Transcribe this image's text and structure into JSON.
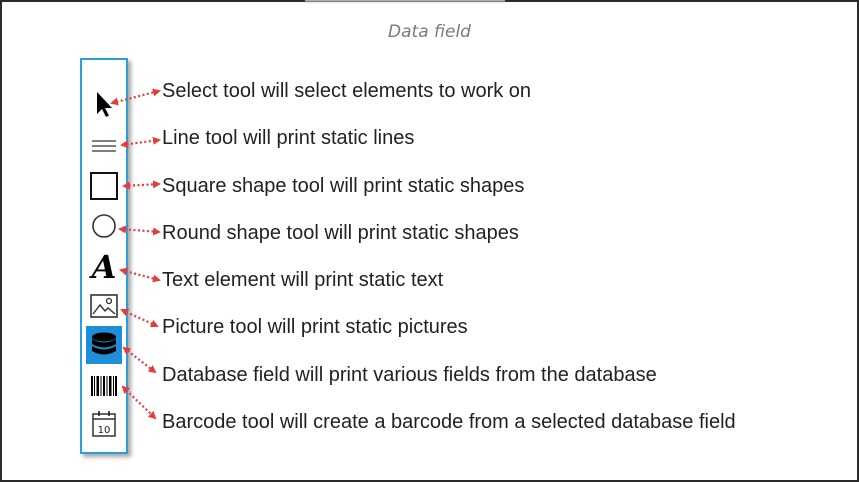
{
  "caption": "Data field",
  "colors": {
    "toolbar_border": "#2a9fe0",
    "selected_tool_bg": "#1e8ed8",
    "arrow": "#e83b3b"
  },
  "tools": [
    {
      "icon": "select-arrow-icon",
      "description": "Select tool will select elements to work on"
    },
    {
      "icon": "line-icon",
      "description": "Line tool will print static lines"
    },
    {
      "icon": "square-icon",
      "description": "Square shape tool will print static shapes"
    },
    {
      "icon": "circle-icon",
      "description": "Round shape tool will print static shapes"
    },
    {
      "icon": "text-a-icon",
      "description": "Text element will print static text"
    },
    {
      "icon": "picture-icon",
      "description": "Picture tool will print static pictures"
    },
    {
      "icon": "database-icon",
      "description": "Database field will print various fields from the database",
      "selected": true
    },
    {
      "icon": "barcode-icon",
      "description": "Barcode tool will create a barcode from a selected database field"
    },
    {
      "icon": "calendar-icon",
      "description": ""
    }
  ],
  "calendar_day": "10"
}
